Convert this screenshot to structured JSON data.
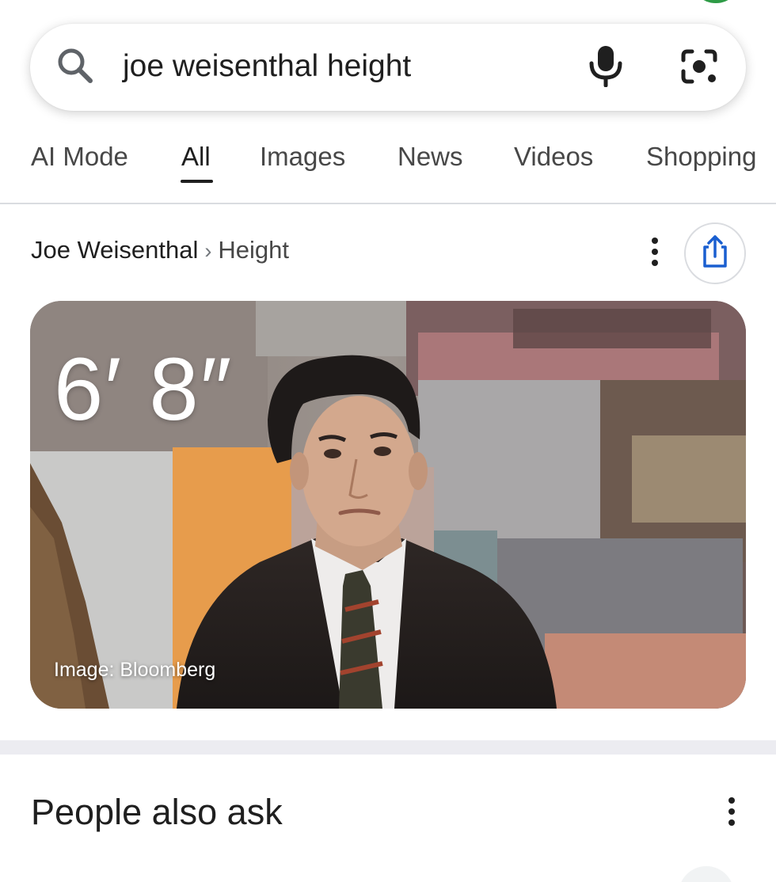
{
  "search": {
    "query": "joe weisenthal height",
    "icons": {
      "left": "search-icon",
      "voice": "mic-icon",
      "lens": "camera-lens-icon"
    }
  },
  "tabs": [
    {
      "label": "AI Mode",
      "active": false
    },
    {
      "label": "All",
      "active": true
    },
    {
      "label": "Images",
      "active": false
    },
    {
      "label": "News",
      "active": false
    },
    {
      "label": "Videos",
      "active": false
    },
    {
      "label": "Shopping",
      "active": false
    }
  ],
  "result": {
    "breadcrumb": {
      "entity": "Joe Weisenthal",
      "separator": "›",
      "attribute": "Height"
    },
    "value": "6′ 8″",
    "image_credit": "Image: Bloomberg"
  },
  "people_also_ask": {
    "title": "People also ask"
  },
  "colors": {
    "text_primary": "#1f1f1f",
    "text_secondary": "#474747",
    "accent_blue": "#1a5fd0",
    "divider": "#dadce0",
    "band": "#ececf1"
  }
}
